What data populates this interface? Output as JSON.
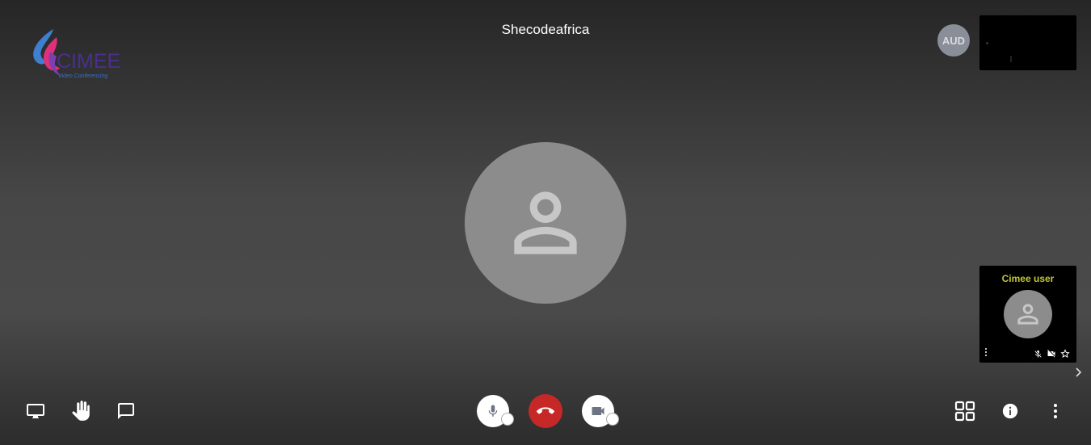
{
  "app": {
    "logo_text": "CIMEE",
    "logo_tagline": "Video Conferencing",
    "meeting_title": "Shecodeafrica"
  },
  "participants": {
    "audience_avatar_label": "AUD",
    "local_user_name": "Cimee user"
  },
  "toolbar": {
    "left": [
      {
        "name": "screen-share-button",
        "icon": "monitor-icon"
      },
      {
        "name": "raise-hand-button",
        "icon": "hand-icon"
      },
      {
        "name": "chat-button",
        "icon": "chat-bubble-icon"
      }
    ],
    "center": [
      {
        "name": "microphone-button",
        "icon": "microphone-icon"
      },
      {
        "name": "hang-up-button",
        "icon": "phone-hangup-icon"
      },
      {
        "name": "camera-button",
        "icon": "video-camera-icon"
      }
    ],
    "right": [
      {
        "name": "tile-view-button",
        "icon": "grid-icon"
      },
      {
        "name": "info-button",
        "icon": "info-icon"
      },
      {
        "name": "more-options-button",
        "icon": "more-vertical-icon"
      }
    ]
  },
  "colors": {
    "hangup": "#c62828",
    "local_user_name": "#c2c734",
    "avatar_bg": "#8c8c8c"
  }
}
